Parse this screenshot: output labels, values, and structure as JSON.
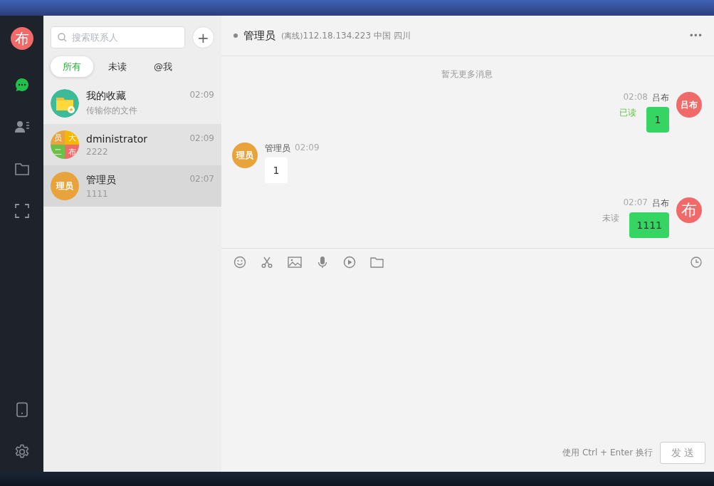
{
  "sidebar": {
    "avatar": "布",
    "nav": [
      {
        "kind": "chat",
        "selected": true
      },
      {
        "kind": "contacts",
        "selected": false
      },
      {
        "kind": "folder",
        "selected": false
      },
      {
        "kind": "fullscreen",
        "selected": false
      }
    ],
    "bottom": [
      {
        "kind": "phone"
      },
      {
        "kind": "settings"
      }
    ]
  },
  "contacts": {
    "search": {
      "placeholder": "搜索联系人"
    },
    "add_button": "+",
    "tabs": [
      {
        "label": "所有",
        "selected": true
      },
      {
        "label": "未读",
        "selected": false
      },
      {
        "label": "@我",
        "selected": false
      }
    ],
    "items": [
      {
        "name": "我的收藏",
        "preview": "传输你的文件",
        "time": "02:09",
        "selected": false,
        "hovered": false,
        "avatar": {
          "kind": "folder"
        }
      },
      {
        "name": "dministrator",
        "preview": "2222",
        "time": "02:09",
        "selected": false,
        "hovered": true,
        "avatar": {
          "kind": "grid",
          "cells": [
            {
              "text": "员",
              "color": "#e8a33d"
            },
            {
              "text": "大",
              "color": "#f5b800"
            },
            {
              "text": "二",
              "color": "#6cc04a"
            },
            {
              "text": "布",
              "color": "#f06a6a"
            }
          ]
        }
      },
      {
        "name": "管理员",
        "preview": "1111",
        "time": "02:07",
        "selected": true,
        "hovered": false,
        "avatar": {
          "kind": "text",
          "text": "理员",
          "color": "#e8a33d"
        }
      }
    ]
  },
  "chat": {
    "title": "管理员",
    "status": "(离线)",
    "location": "112.18.134.223 中国 四川",
    "more": "•••",
    "notice": "暂无更多消息",
    "messages": [
      {
        "kind": "out",
        "time": "02:08",
        "sender": "吕布",
        "status": "已读",
        "read": true,
        "text": "1",
        "avatar": {
          "text": "吕布",
          "color": "#f06a6a",
          "large": false
        }
      },
      {
        "kind": "in",
        "time": "02:09",
        "sender": "管理员",
        "text": "1",
        "avatar": {
          "text": "理员",
          "color": "#e8a33d",
          "large": false
        }
      },
      {
        "kind": "out",
        "time": "02:07",
        "sender": "吕布",
        "status": "未读",
        "read": false,
        "text": "1111",
        "avatar": {
          "text": "布",
          "color": "#f06a6a",
          "large": true
        }
      }
    ],
    "tools": [
      {
        "kind": "emoji"
      },
      {
        "kind": "scissors"
      },
      {
        "kind": "image"
      },
      {
        "kind": "microphone"
      },
      {
        "kind": "video"
      },
      {
        "kind": "folder"
      }
    ],
    "hint": "使用 Ctrl + Enter 换行",
    "send": "发 送"
  }
}
